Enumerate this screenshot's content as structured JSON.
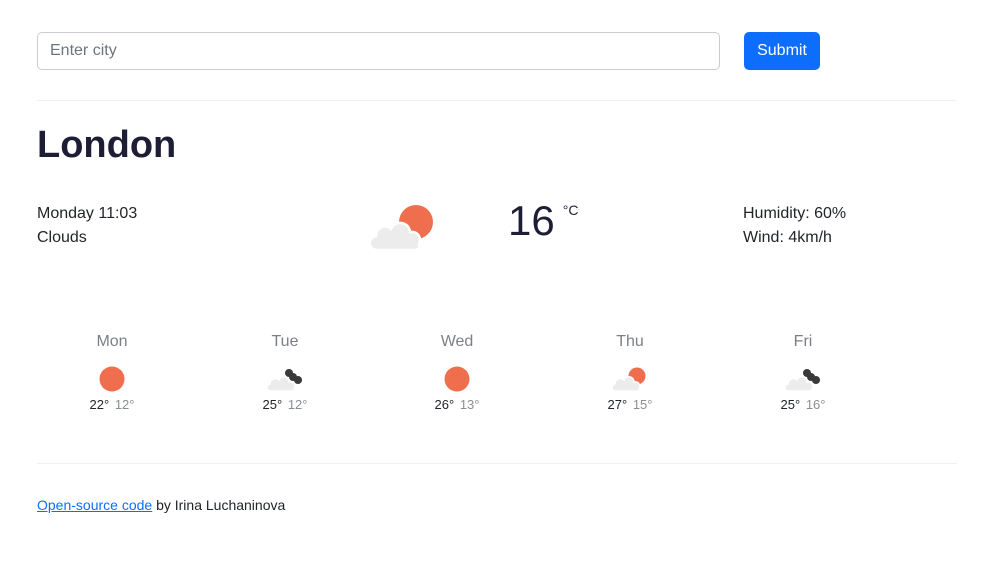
{
  "search": {
    "placeholder": "Enter city",
    "value": "",
    "submit_label": "Submit"
  },
  "current": {
    "city": "London",
    "datetime": "Monday 11:03",
    "description": "Clouds",
    "icon": "sun-behind-cloud-icon",
    "temperature": "16",
    "unit": "°C",
    "humidity": "Humidity: 60%",
    "wind": "Wind: 4km/h"
  },
  "forecast": [
    {
      "day": "Mon",
      "icon": "sun-icon",
      "max": "22°",
      "min": "12°"
    },
    {
      "day": "Tue",
      "icon": "dark-clouds-icon",
      "max": "25°",
      "min": "12°"
    },
    {
      "day": "Wed",
      "icon": "sun-icon",
      "max": "26°",
      "min": "13°"
    },
    {
      "day": "Thu",
      "icon": "sun-behind-cloud-icon",
      "max": "27°",
      "min": "15°"
    },
    {
      "day": "Fri",
      "icon": "dark-clouds-icon",
      "max": "25°",
      "min": "16°"
    }
  ],
  "footer": {
    "link_text": "Open-source code",
    "suffix": " by Irina Luchaninova"
  },
  "colors": {
    "accent": "#0d6efd",
    "sun": "#ee6e4d",
    "cloud": "#ececec",
    "dark_cloud": "#3a3a3a"
  }
}
